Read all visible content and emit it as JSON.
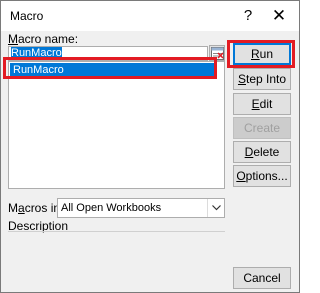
{
  "window": {
    "title": "Macro",
    "help_glyph": "?",
    "close_glyph": "✕"
  },
  "macro_name": {
    "label_underlined": "M",
    "label_rest": "acro name:",
    "value": "RunMacro"
  },
  "macro_list": {
    "items": [
      "RunMacro"
    ],
    "selected": "RunMacro"
  },
  "buttons": {
    "run": {
      "underlined": "R",
      "rest": "un"
    },
    "step_into": {
      "underlined": "S",
      "rest": "tep Into"
    },
    "edit": {
      "underlined": "E",
      "rest": "dit"
    },
    "create": {
      "underlined": "",
      "rest": "Create"
    },
    "delete": {
      "underlined": "D",
      "rest": "elete"
    },
    "options": {
      "underlined": "O",
      "rest": "ptions..."
    },
    "cancel": {
      "underlined": "",
      "rest": "Cancel"
    }
  },
  "macros_in": {
    "label_pre": "M",
    "label_underlined": "a",
    "label_rest": "cros in:",
    "value": "All Open Workbooks"
  },
  "description": {
    "label": "Description"
  },
  "colors": {
    "highlight": "#e31b23",
    "selection": "#0078d7"
  },
  "icons": [
    "help-icon",
    "close-icon",
    "browse-icon",
    "dropdown-arrow-icon"
  ]
}
